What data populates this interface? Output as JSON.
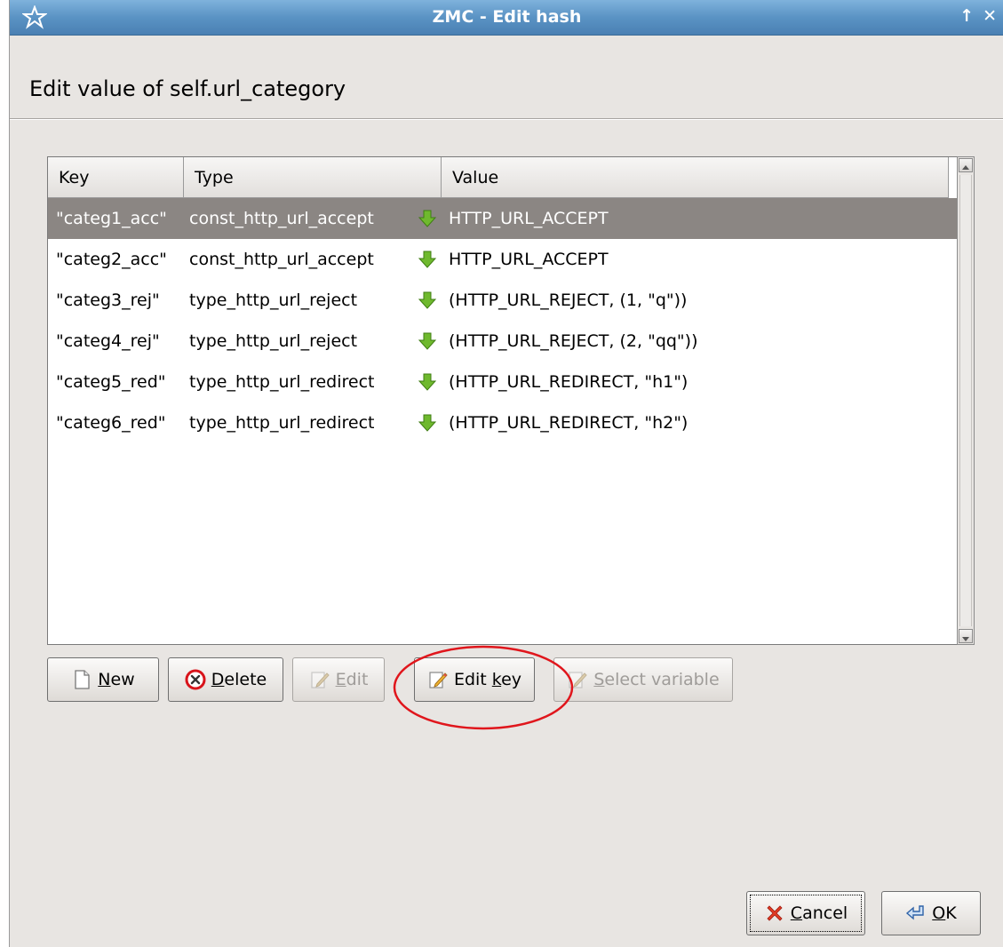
{
  "window": {
    "title": "ZMC - Edit hash",
    "restore_glyph": "↑",
    "close_glyph": "✕"
  },
  "heading": "Edit value of self.url_category",
  "table": {
    "columns": [
      "Key",
      "Type",
      "Value"
    ],
    "rows": [
      {
        "key": "\"categ1_acc\"",
        "type": "const_http_url_accept",
        "value": "HTTP_URL_ACCEPT",
        "selected": true
      },
      {
        "key": "\"categ2_acc\"",
        "type": "const_http_url_accept",
        "value": "HTTP_URL_ACCEPT"
      },
      {
        "key": "\"categ3_rej\"",
        "type": "type_http_url_reject",
        "value": "(HTTP_URL_REJECT, (1, \"q\"))"
      },
      {
        "key": "\"categ4_rej\"",
        "type": "type_http_url_reject",
        "value": "(HTTP_URL_REJECT, (2, \"qq\"))"
      },
      {
        "key": "\"categ5_red\"",
        "type": "type_http_url_redirect",
        "value": "(HTTP_URL_REDIRECT, \"h1\")"
      },
      {
        "key": "\"categ6_red\"",
        "type": "type_http_url_redirect",
        "value": "(HTTP_URL_REDIRECT, \"h2\")"
      }
    ]
  },
  "actions": {
    "new": {
      "mnemonic": "N",
      "rest": "ew"
    },
    "delete": {
      "mnemonic": "D",
      "rest": "elete"
    },
    "edit": {
      "mnemonic": "E",
      "rest": "dit"
    },
    "edit_key": {
      "before": "Edit ",
      "mnemonic": "k",
      "rest": "ey"
    },
    "select_variable": {
      "mnemonic": "S",
      "rest": "elect variable"
    }
  },
  "dialog": {
    "cancel": {
      "mnemonic": "C",
      "rest": "ancel"
    },
    "ok": {
      "mnemonic": "O",
      "rest": "K"
    }
  },
  "colors": {
    "titlebar": "#5a93c4",
    "selected_row": "#8b8683",
    "arrow_icon": "#6fb92e",
    "annotation_circle": "#e0161c"
  },
  "icons": [
    "app-star-icon",
    "green-down-arrow-icon",
    "document-icon",
    "delete-circle-icon",
    "pencil-icon",
    "cancel-x-icon",
    "ok-enter-icon"
  ]
}
